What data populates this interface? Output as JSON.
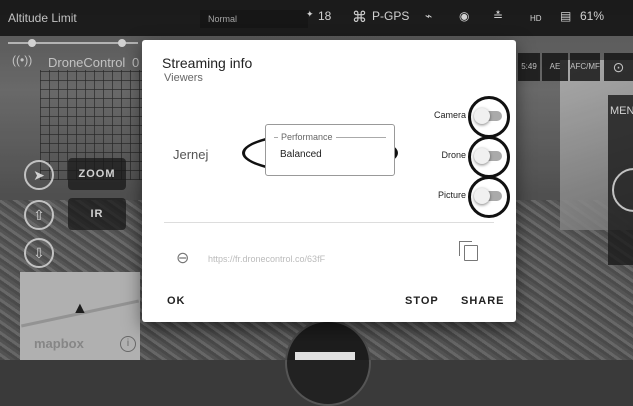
{
  "top_bar": {
    "title": "Altitude Limit",
    "mode": "Normal",
    "satellites": "18",
    "gps_mode": "P-GPS",
    "hd_label": "HD",
    "battery": "61%"
  },
  "overlay": {
    "app_name": "DroneControl",
    "app_counter": "0",
    "zoom_label": "ZOOM",
    "ir_label": "IR",
    "mapbox_label": "mapbox",
    "info_label": "i",
    "time_badge": "5:49",
    "ae_badge": "AE",
    "af_badge": "AFC/MF",
    "menu_label": "MEN"
  },
  "dialog": {
    "title": "Streaming info",
    "subtitle": "Viewers",
    "viewer_name": "Jernej",
    "performance_legend": "Performance",
    "performance_value": "Balanced",
    "toggles": [
      {
        "label": "Camera",
        "on": false
      },
      {
        "label": "Drone",
        "on": false
      },
      {
        "label": "Picture",
        "on": false
      }
    ],
    "link_url": "https://fr.dronecontrol.co/63fF",
    "ok_label": "OK",
    "stop_label": "STOP",
    "share_label": "SHARE"
  },
  "icons": {
    "link": "link-icon",
    "copy": "copy-icon",
    "signal": "signal-icon",
    "gps": "drone-icon"
  }
}
